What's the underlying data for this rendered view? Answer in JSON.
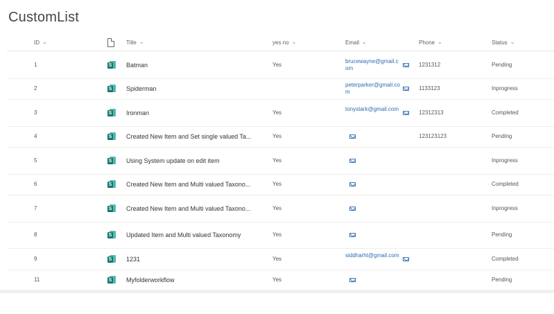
{
  "list_title": "CustomList",
  "columns": {
    "id": "ID",
    "title": "Title",
    "yesno": "yes no",
    "email": "Email",
    "phone": "Phone",
    "status": "Status"
  },
  "colors": {
    "accent": "#0b7a6c",
    "link": "#2b6cb0"
  },
  "rows": [
    {
      "id": "1",
      "title": "Batman",
      "yesno": "Yes",
      "email": "brucewayne@gmail.com",
      "phone": "1231312",
      "status": "Pending"
    },
    {
      "id": "2",
      "title": "Spiderman",
      "yesno": "",
      "email": "peterparker@gmail.com",
      "phone": "1133123",
      "status": "Inprogress"
    },
    {
      "id": "3",
      "title": "Ironman",
      "yesno": "Yes",
      "email": "tonystark@gmail.com",
      "phone": "12312313",
      "status": "Completed"
    },
    {
      "id": "4",
      "title": "Created New Item and Set single valued Ta...",
      "yesno": "Yes",
      "email": "",
      "phone": "123123123",
      "status": "Pending"
    },
    {
      "id": "5",
      "title": "Using System update on edit item",
      "yesno": "Yes",
      "email": "",
      "phone": "",
      "status": "Inprogress"
    },
    {
      "id": "6",
      "title": "Created New Item and Multi valued Taxono...",
      "yesno": "Yes",
      "email": "",
      "phone": "",
      "status": "Completed"
    },
    {
      "id": "7",
      "title": "Created New Item and Multi valued Taxono...",
      "yesno": "Yes",
      "email": "",
      "phone": "",
      "status": "Inprogress"
    },
    {
      "id": "8",
      "title": "Updated Item and Multi valued Taxonomy",
      "yesno": "Yes",
      "email": "",
      "phone": "",
      "status": "Pending"
    },
    {
      "id": "9",
      "title": "1231",
      "yesno": "Yes",
      "email": "siddharht@gmail.com",
      "phone": "",
      "status": "Completed"
    },
    {
      "id": "11",
      "title": "Myfolderworkflow",
      "yesno": "Yes",
      "email": "",
      "phone": "",
      "status": "Pending"
    }
  ]
}
